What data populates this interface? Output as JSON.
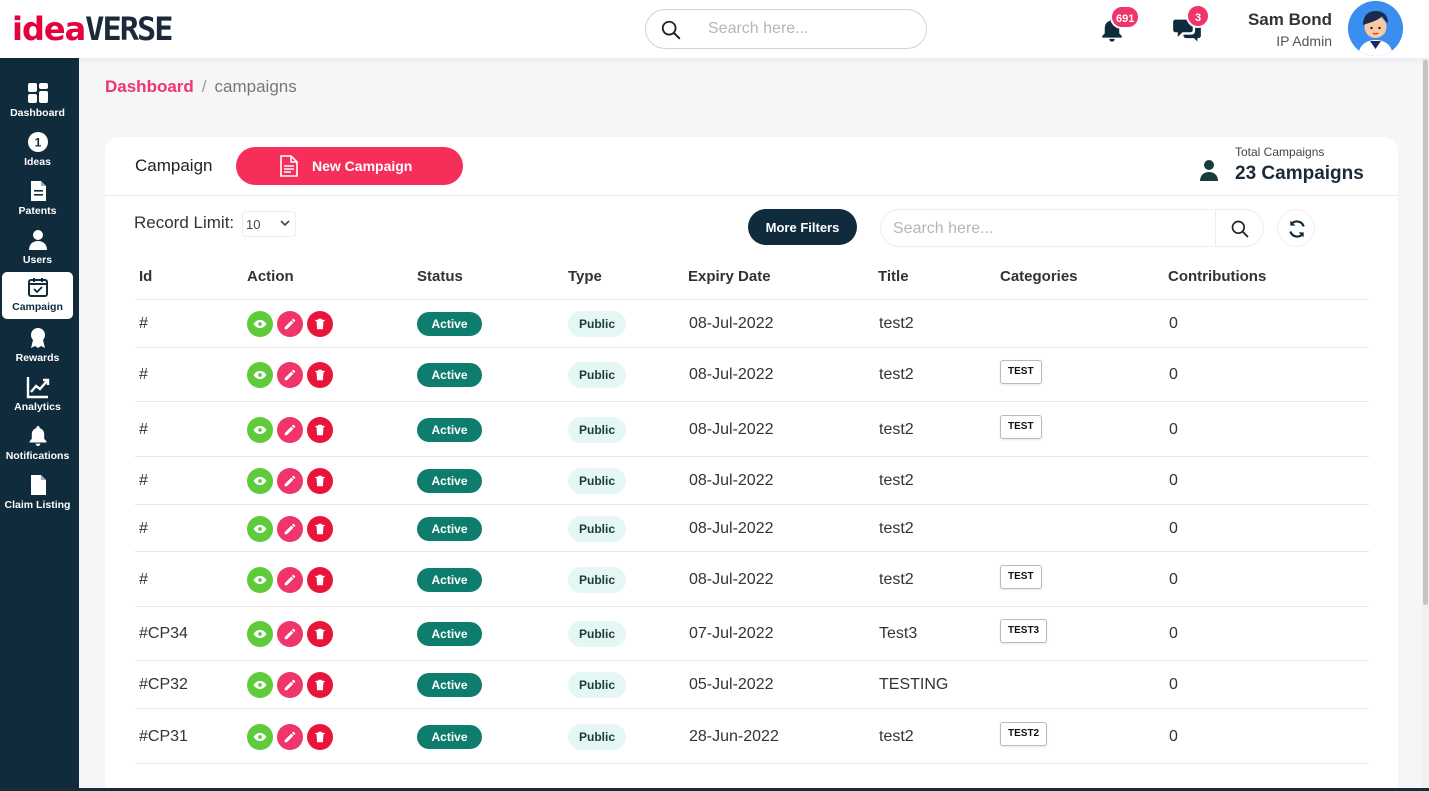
{
  "header": {
    "logo_part1": "idea",
    "logo_part2": "VERSE",
    "search_placeholder": "Search here...",
    "notifications_count": "691",
    "messages_count": "3",
    "user_name": "Sam Bond",
    "user_role": "IP Admin"
  },
  "sidebar": {
    "items": [
      {
        "label": "Dashboard",
        "icon": "dashboard-icon"
      },
      {
        "label": "Ideas",
        "icon": "ideas-icon"
      },
      {
        "label": "Patents",
        "icon": "patents-icon"
      },
      {
        "label": "Users",
        "icon": "users-icon"
      },
      {
        "label": "Campaign",
        "icon": "campaign-icon",
        "active": true
      },
      {
        "label": "Rewards",
        "icon": "rewards-icon"
      },
      {
        "label": "Analytics",
        "icon": "analytics-icon"
      },
      {
        "label": "Notifications",
        "icon": "notifications-icon"
      },
      {
        "label": "Claim Listing",
        "icon": "claim-listing-icon"
      }
    ]
  },
  "breadcrumb": {
    "home": "Dashboard",
    "separator": "/",
    "current": "campaigns"
  },
  "card": {
    "title": "Campaign",
    "new_button": "New Campaign",
    "total_label": "Total Campaigns",
    "total_value": "23 Campaigns",
    "record_limit_label": "Record Limit:",
    "record_limit_value": "10",
    "more_filters": "More Filters",
    "search_placeholder": "Search here..."
  },
  "table": {
    "columns": [
      "Id",
      "Action",
      "Status",
      "Type",
      "Expiry Date",
      "Title",
      "Categories",
      "Contributions"
    ],
    "rows": [
      {
        "id": "#",
        "status": "Active",
        "type": "Public",
        "expiry": "08-Jul-2022",
        "title": "test2",
        "category": "",
        "contributions": "0"
      },
      {
        "id": "#",
        "status": "Active",
        "type": "Public",
        "expiry": "08-Jul-2022",
        "title": "test2",
        "category": "TEST",
        "contributions": "0"
      },
      {
        "id": "#",
        "status": "Active",
        "type": "Public",
        "expiry": "08-Jul-2022",
        "title": "test2",
        "category": "TEST",
        "contributions": "0"
      },
      {
        "id": "#",
        "status": "Active",
        "type": "Public",
        "expiry": "08-Jul-2022",
        "title": "test2",
        "category": "",
        "contributions": "0"
      },
      {
        "id": "#",
        "status": "Active",
        "type": "Public",
        "expiry": "08-Jul-2022",
        "title": "test2",
        "category": "",
        "contributions": "0"
      },
      {
        "id": "#",
        "status": "Active",
        "type": "Public",
        "expiry": "08-Jul-2022",
        "title": "test2",
        "category": "TEST",
        "contributions": "0"
      },
      {
        "id": "#CP34",
        "status": "Active",
        "type": "Public",
        "expiry": "07-Jul-2022",
        "title": "Test3",
        "category": "TEST3",
        "contributions": "0"
      },
      {
        "id": "#CP32",
        "status": "Active",
        "type": "Public",
        "expiry": "05-Jul-2022",
        "title": "TESTING",
        "category": "",
        "contributions": "0"
      },
      {
        "id": "#CP31",
        "status": "Active",
        "type": "Public",
        "expiry": "28-Jun-2022",
        "title": "test2",
        "category": "TEST2",
        "contributions": "0"
      }
    ]
  },
  "colors": {
    "accent": "#f52f59",
    "sidebar": "#0f2b3c",
    "active_status": "#0f7d6e",
    "view_action": "#5fcb3a"
  }
}
